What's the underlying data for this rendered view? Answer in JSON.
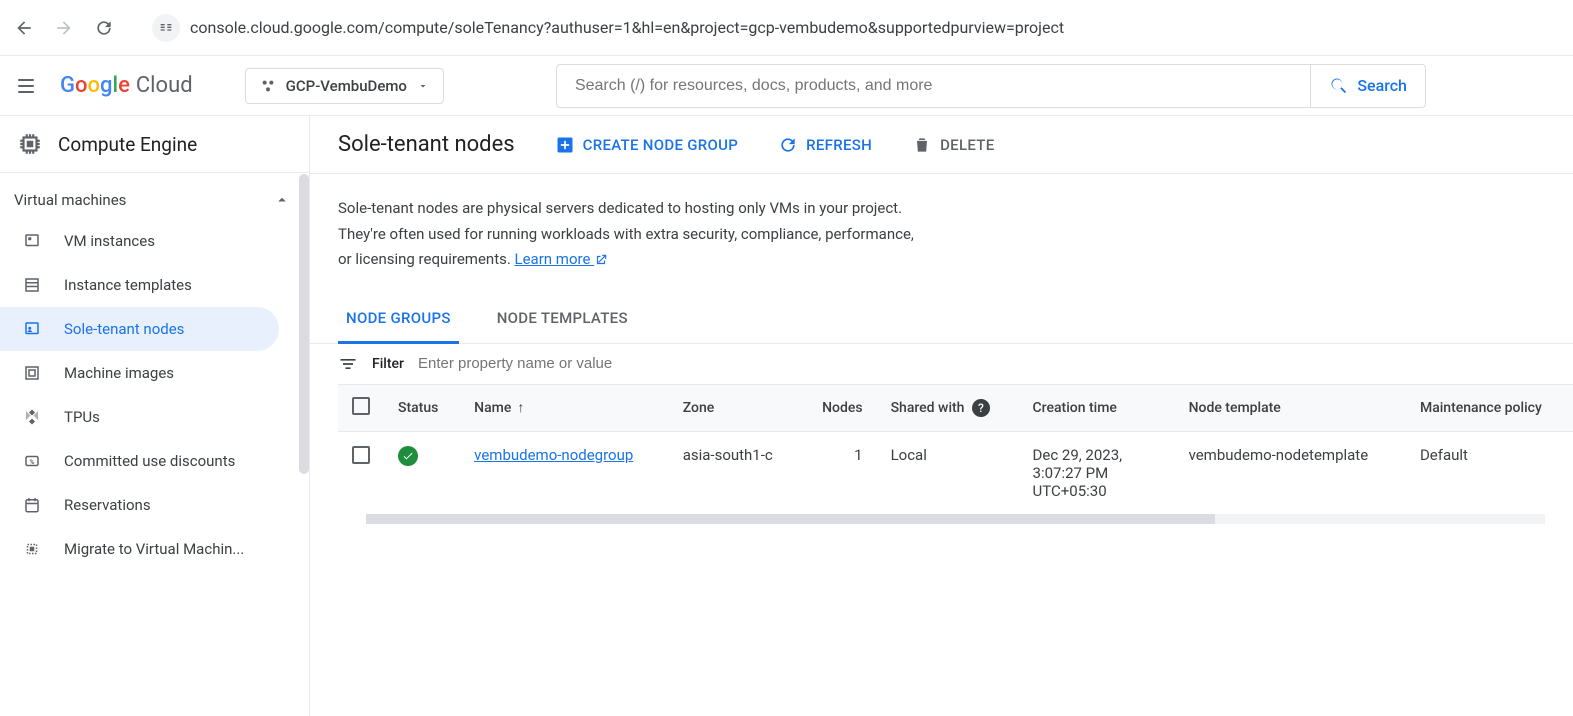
{
  "browser": {
    "url": "console.cloud.google.com/compute/soleTenancy?authuser=1&hl=en&project=gcp-vembudemo&supportedpurview=project"
  },
  "header": {
    "logo_text": "Cloud",
    "project_name": "GCP-VembuDemo",
    "search_placeholder": "Search (/) for resources, docs, products, and more",
    "search_button": "Search"
  },
  "sidebar": {
    "product_title": "Compute Engine",
    "section_label": "Virtual machines",
    "items": [
      {
        "label": "VM instances"
      },
      {
        "label": "Instance templates"
      },
      {
        "label": "Sole-tenant nodes"
      },
      {
        "label": "Machine images"
      },
      {
        "label": "TPUs"
      },
      {
        "label": "Committed use discounts"
      },
      {
        "label": "Reservations"
      },
      {
        "label": "Migrate to Virtual Machin..."
      }
    ]
  },
  "page": {
    "title": "Sole-tenant nodes",
    "actions": {
      "create": "CREATE NODE GROUP",
      "refresh": "REFRESH",
      "delete": "DELETE"
    },
    "description_line1": "Sole-tenant nodes are physical servers dedicated to hosting only VMs in your project.",
    "description_line2": "They're often used for running workloads with extra security, compliance, performance,",
    "description_line3_prefix": "or licensing requirements. ",
    "learn_more": "Learn more",
    "tabs": {
      "node_groups": "NODE GROUPS",
      "node_templates": "NODE TEMPLATES"
    },
    "filter_label": "Filter",
    "filter_placeholder": "Enter property name or value",
    "columns": {
      "status": "Status",
      "name": "Name",
      "zone": "Zone",
      "nodes": "Nodes",
      "shared_with": "Shared with",
      "creation_time": "Creation time",
      "node_template": "Node template",
      "maintenance_policy": "Maintenance policy"
    },
    "rows": [
      {
        "name": "vembudemo-nodegroup",
        "zone": "asia-south1-c",
        "nodes": "1",
        "shared_with": "Local",
        "creation_time": "Dec 29, 2023, 3:07:27 PM UTC+05:30",
        "node_template": "vembudemo-nodetemplate",
        "maintenance_policy": "Default"
      }
    ]
  }
}
